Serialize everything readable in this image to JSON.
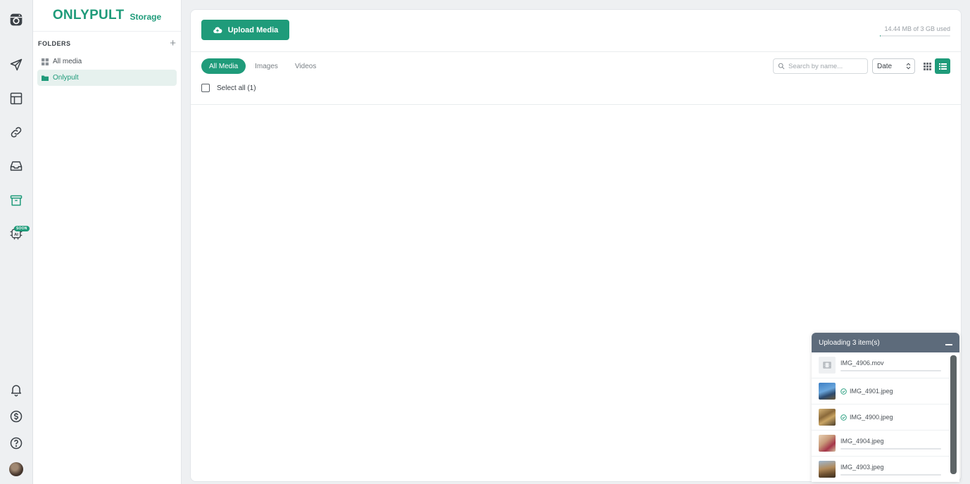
{
  "rail": {
    "icons": [
      "camera-icon",
      "send-icon",
      "layout-icon",
      "link-icon",
      "inbox-icon",
      "archive-icon",
      "ai-chip-icon",
      "bell-icon",
      "dollar-icon",
      "help-icon"
    ],
    "soon_badge": "SOON",
    "ai_label": "AI",
    "accent": "#1f9b7a"
  },
  "sidebar": {
    "brand": "ONLYPULT",
    "brand_sub": "Storage",
    "folders_label": "FOLDERS",
    "add_symbol": "+",
    "items": [
      {
        "label": "All media",
        "icon": "grid-icon"
      },
      {
        "label": "Onlypult",
        "icon": "folder-icon"
      }
    ]
  },
  "toolbar": {
    "upload_label": "Upload Media",
    "usage_text": "14.44 MB of 3 GB used",
    "usage_percent": 0.5
  },
  "filters": {
    "tabs": [
      {
        "label": "All Media"
      },
      {
        "label": "Images"
      },
      {
        "label": "Videos"
      }
    ],
    "search_placeholder": "Search by name...",
    "sort_value": "Date",
    "select_all": "Select all (1)"
  },
  "upload_popup": {
    "title": "Uploading 3 item(s)",
    "items": [
      {
        "name": "IMG_4906.mov",
        "done": false,
        "progress": 0
      },
      {
        "name": "IMG_4901.jpeg",
        "done": true
      },
      {
        "name": "IMG_4900.jpeg",
        "done": true
      },
      {
        "name": "IMG_4904.jpeg",
        "done": false,
        "progress": 0
      },
      {
        "name": "IMG_4903.jpeg",
        "done": false,
        "progress": 0
      }
    ]
  }
}
